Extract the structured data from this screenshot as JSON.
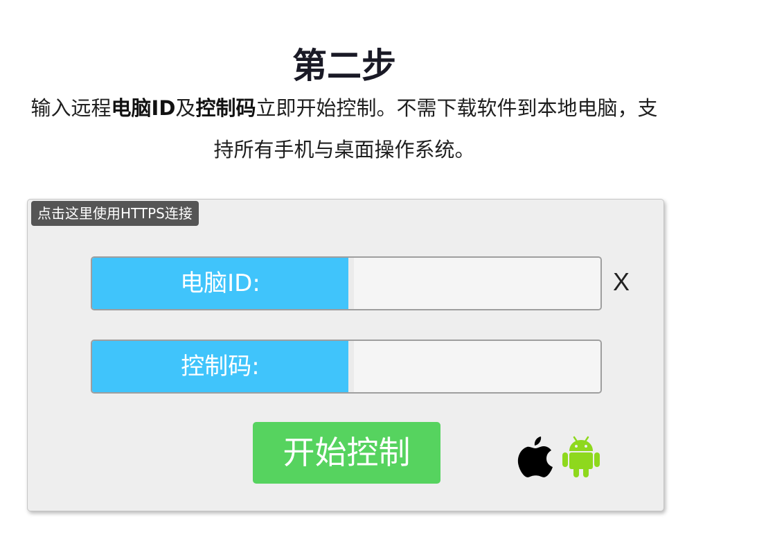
{
  "header": {
    "title": "第二步",
    "desc_part1": "输入远程",
    "desc_bold1": "电脑ID",
    "desc_part2": "及",
    "desc_bold2": "控制码",
    "desc_part3": "立即开始控制。不需下载软件到本地电脑，支持所有手机与桌面操作系统。"
  },
  "panel": {
    "https_link": "点击这里使用HTTPS连接",
    "id_field": {
      "label": "电脑ID:",
      "value": "",
      "clear": "X"
    },
    "code_field": {
      "label": "控制码:",
      "value": ""
    },
    "start_button": "开始控制",
    "platform_icons": [
      "apple-icon",
      "android-icon"
    ]
  },
  "colors": {
    "label_blue": "#40c4fb",
    "button_green": "#56d35f",
    "badge_gray": "#555555",
    "android_green": "#8ed81d"
  }
}
